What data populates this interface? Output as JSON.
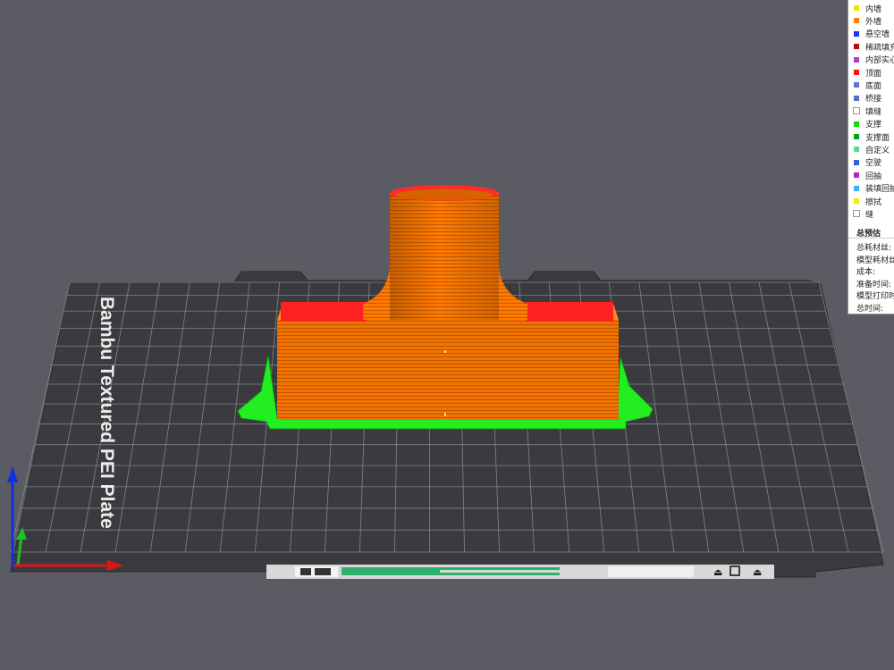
{
  "plate": {
    "label": "Bambu Textured PEI Plate"
  },
  "legend": {
    "items": [
      {
        "label": "内墙",
        "color": "#f2e300"
      },
      {
        "label": "外墙",
        "color": "#ff7f00"
      },
      {
        "label": "悬空墙",
        "color": "#2030ff"
      },
      {
        "label": "稀疏填充",
        "color": "#b01010"
      },
      {
        "label": "内部实心",
        "color": "#b040c0"
      },
      {
        "label": "顶面",
        "color": "#ff1010"
      },
      {
        "label": "底面",
        "color": "#6070e0"
      },
      {
        "label": "桥接",
        "color": "#5070c0"
      },
      {
        "label": "填缝",
        "color": "#ffffff"
      },
      {
        "label": "支撑",
        "color": "#10e000"
      },
      {
        "label": "支撑面",
        "color": "#00a020"
      },
      {
        "label": "自定义",
        "color": "#50e090"
      },
      {
        "label": "空驶",
        "color": "#3060e0"
      },
      {
        "label": "回抽",
        "color": "#c020c0"
      },
      {
        "label": "装填回抽",
        "color": "#40b0f0"
      },
      {
        "label": "擦拭",
        "color": "#f0f000"
      },
      {
        "label": "缝",
        "color": "#ffffff"
      }
    ]
  },
  "summary": {
    "title": "总预估",
    "rows": [
      "总耗材丝:",
      "模型耗材丝:",
      "成本:",
      "准备时间:",
      "模型打印时间:",
      "总时间:"
    ]
  },
  "colors": {
    "background": "#5b5b63",
    "plate": "#3b3b3f",
    "model_orange": "#ff7a00",
    "top_red": "#ff2020",
    "support_green": "#22ee22"
  }
}
